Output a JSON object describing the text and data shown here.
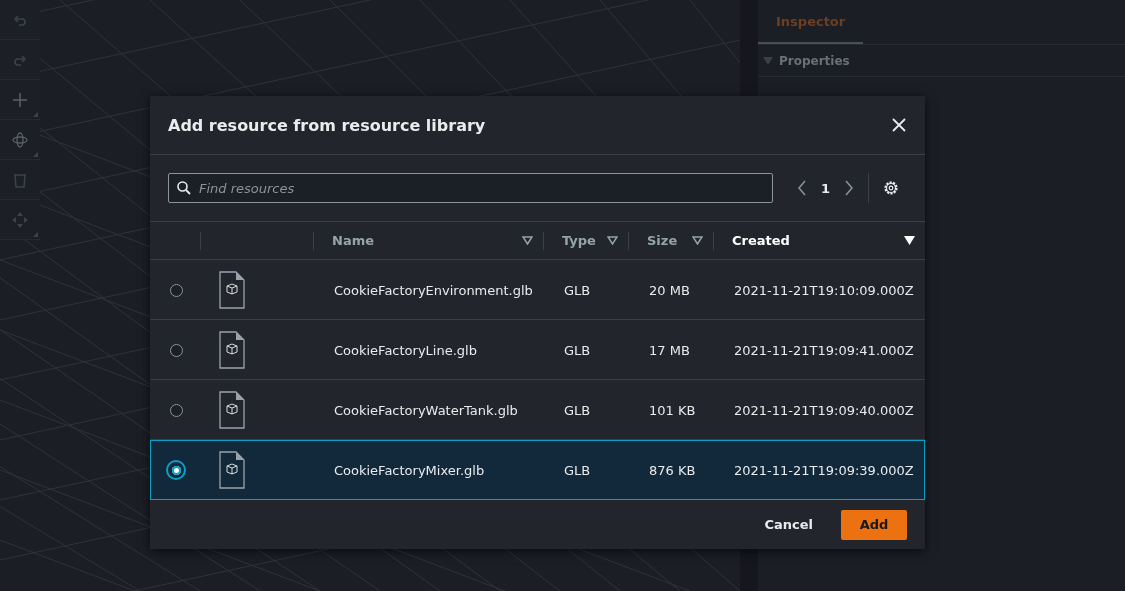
{
  "inspector": {
    "tabs": [
      {
        "label": "Inspector",
        "selected": true
      }
    ],
    "sections": [
      {
        "label": "Properties",
        "expanded": true
      }
    ]
  },
  "dialog": {
    "title": "Add resource from resource library",
    "search": {
      "placeholder": "Find resources"
    },
    "page": "1",
    "columns": [
      {
        "label": "Name",
        "sorted": false
      },
      {
        "label": "Type",
        "sorted": false
      },
      {
        "label": "Size",
        "sorted": false
      },
      {
        "label": "Created",
        "sorted": true
      }
    ],
    "rows": [
      {
        "name": "CookieFactoryEnvironment.glb",
        "type": "GLB",
        "size": "20 MB",
        "created": "2021-11-21T19:10:09.000Z",
        "selected": false
      },
      {
        "name": "CookieFactoryLine.glb",
        "type": "GLB",
        "size": "17 MB",
        "created": "2021-11-21T19:09:41.000Z",
        "selected": false
      },
      {
        "name": "CookieFactoryWaterTank.glb",
        "type": "GLB",
        "size": "101 KB",
        "created": "2021-11-21T19:09:40.000Z",
        "selected": false
      },
      {
        "name": "CookieFactoryMixer.glb",
        "type": "GLB",
        "size": "876 KB",
        "created": "2021-11-21T19:09:39.000Z",
        "selected": true
      }
    ],
    "buttons": [
      {
        "label": "Cancel",
        "kind": "secondary"
      },
      {
        "label": "Add",
        "kind": "primary"
      }
    ]
  }
}
